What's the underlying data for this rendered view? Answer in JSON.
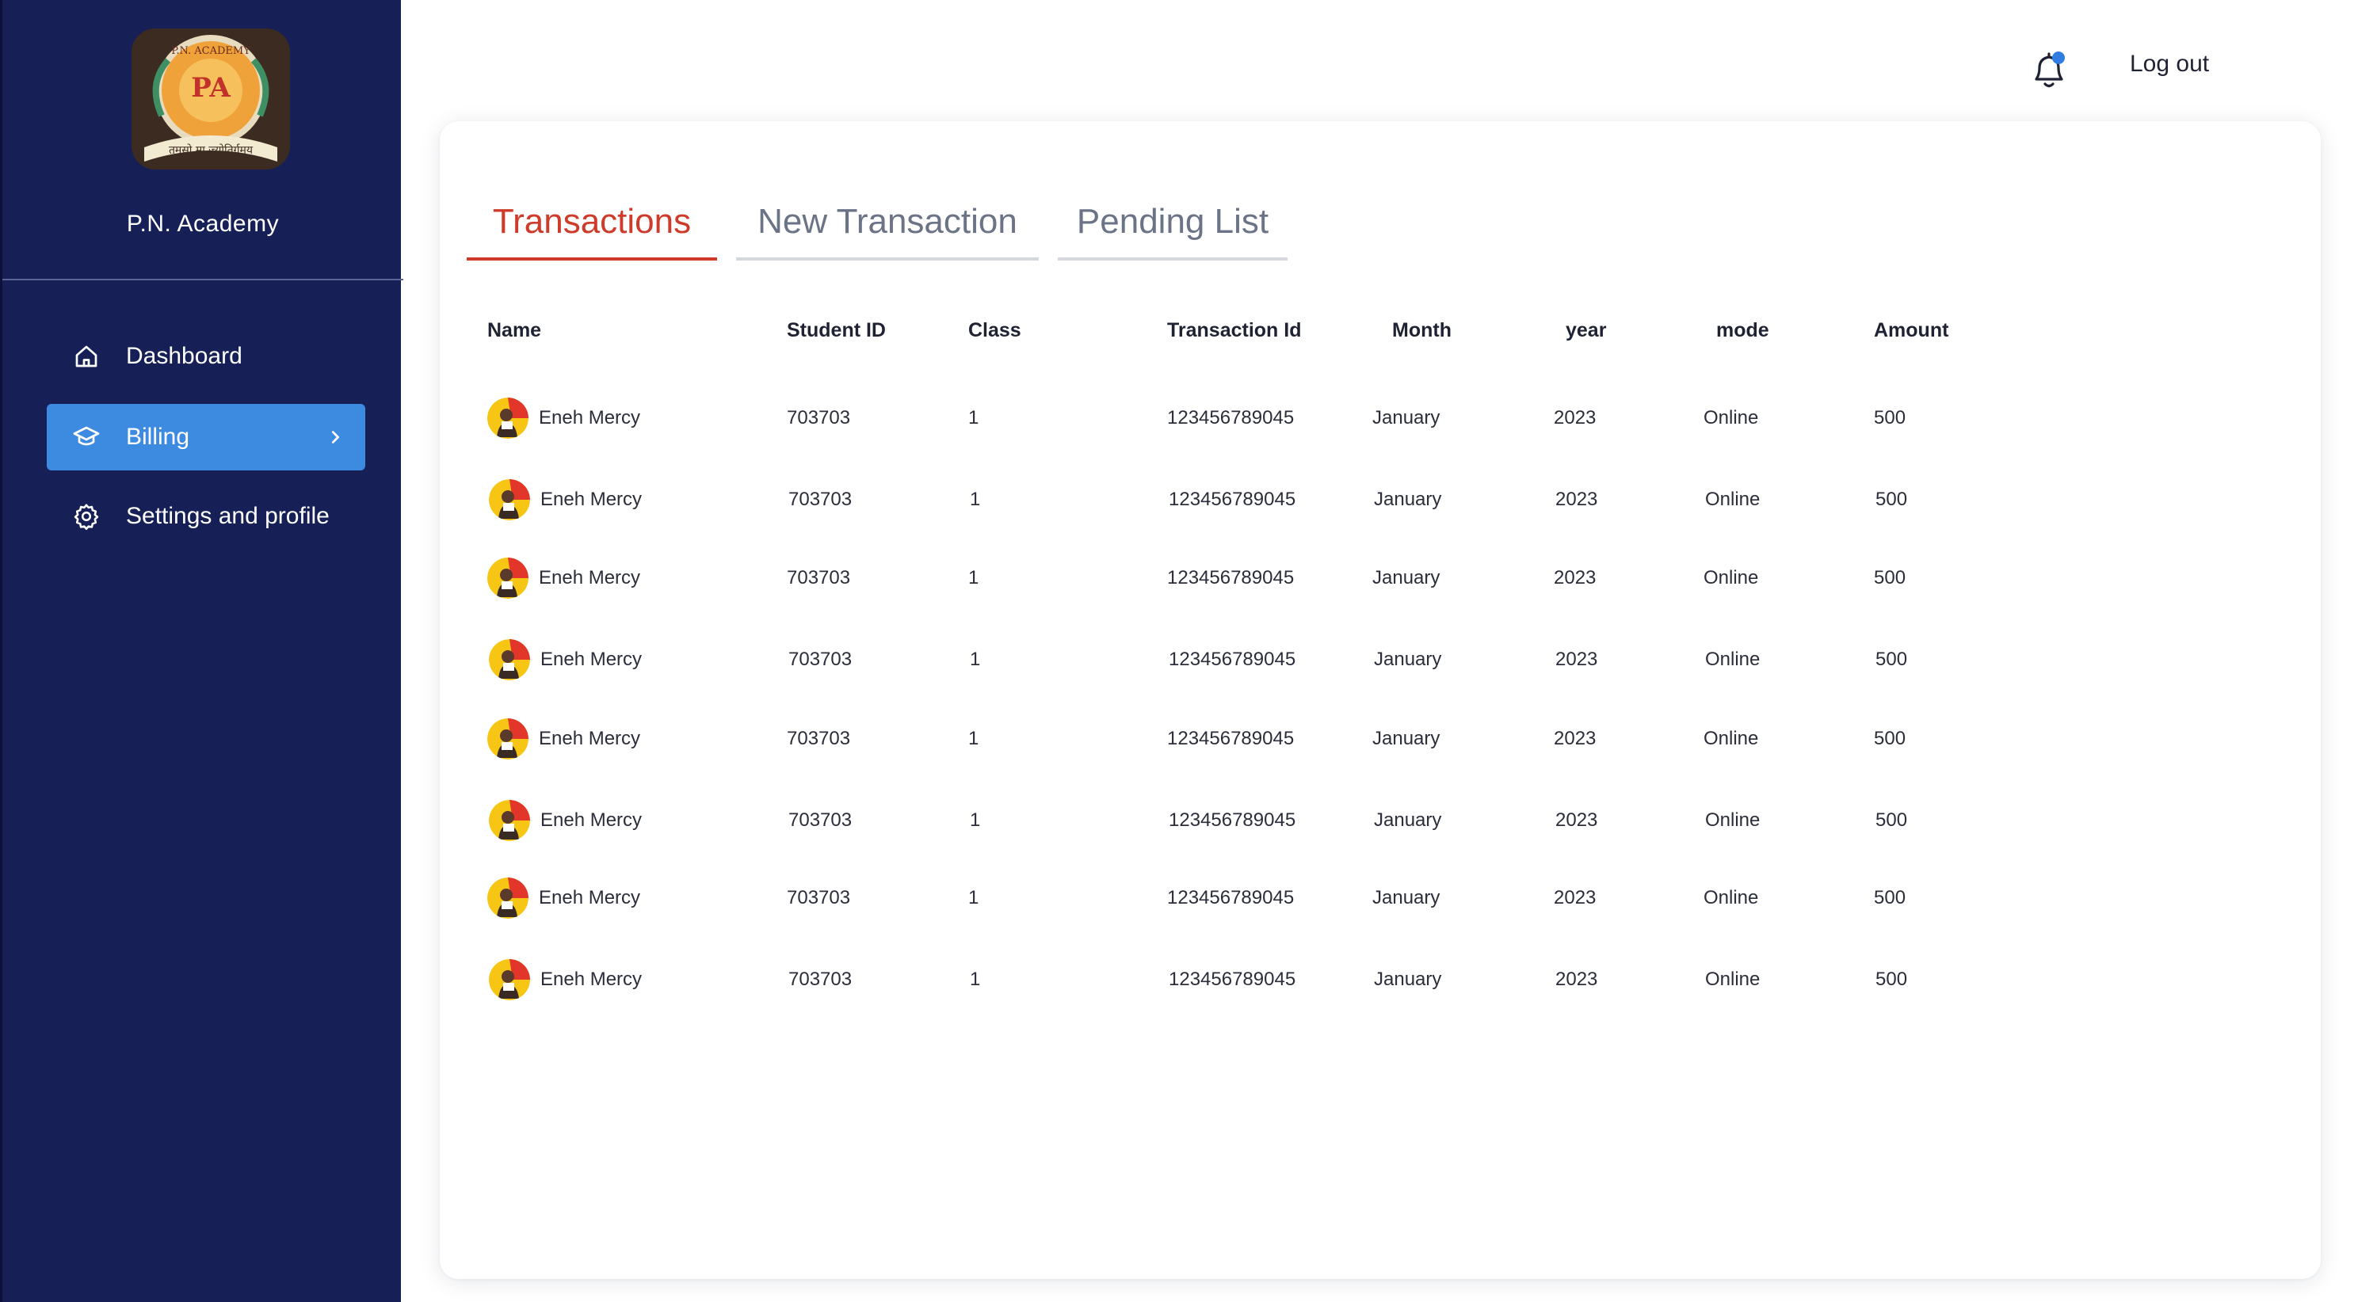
{
  "brand": {
    "name": "P.N. Academy",
    "logo_text": "P.N. ACADEMY",
    "logo_motto": "तमसो मा ज्योतिर्गमय"
  },
  "sidebar": {
    "items": [
      {
        "label": "Dashboard",
        "icon": "home-icon"
      },
      {
        "label": "Billing",
        "icon": "billing-icon",
        "active": true
      },
      {
        "label": "Settings and profile",
        "icon": "gear-icon"
      }
    ]
  },
  "topbar": {
    "logout_label": "Log out",
    "notification_dot_color": "#2f7de1"
  },
  "tabs": [
    {
      "label": "Transactions",
      "active": true
    },
    {
      "label": "New Transaction",
      "active": false
    },
    {
      "label": "Pending List",
      "active": false
    }
  ],
  "table": {
    "headers": [
      "Name",
      "Student ID",
      "Class",
      "Transaction Id",
      "Month",
      "year",
      "mode",
      "Amount"
    ],
    "rows": [
      [
        "Eneh Mercy",
        "703703",
        "1",
        "123456789045",
        "January",
        "2023",
        "Online",
        "500"
      ],
      [
        "Eneh Mercy",
        "703703",
        "1",
        "123456789045",
        "January",
        "2023",
        "Online",
        "500"
      ],
      [
        "Eneh Mercy",
        "703703",
        "1",
        "123456789045",
        "January",
        "2023",
        "Online",
        "500"
      ],
      [
        "Eneh Mercy",
        "703703",
        "1",
        "123456789045",
        "January",
        "2023",
        "Online",
        "500"
      ],
      [
        "Eneh Mercy",
        "703703",
        "1",
        "123456789045",
        "January",
        "2023",
        "Online",
        "500"
      ],
      [
        "Eneh Mercy",
        "703703",
        "1",
        "123456789045",
        "January",
        "2023",
        "Online",
        "500"
      ],
      [
        "Eneh Mercy",
        "703703",
        "1",
        "123456789045",
        "January",
        "2023",
        "Online",
        "500"
      ],
      [
        "Eneh Mercy",
        "703703",
        "1",
        "123456789045",
        "January",
        "2023",
        "Online",
        "500"
      ]
    ]
  },
  "colors": {
    "sidebar_bg": "#162056",
    "active_nav": "#3d8be0",
    "active_tab": "#cf3b2b"
  }
}
